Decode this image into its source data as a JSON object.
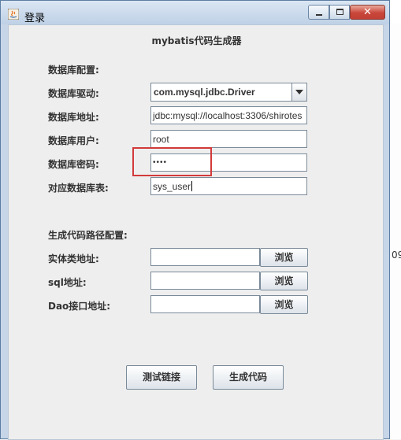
{
  "window": {
    "title": "登录",
    "form_title": "mybatis代码生成器"
  },
  "db_config": {
    "section_label": "数据库配置:",
    "driver_label": "数据库驱动:",
    "driver_value": "com.mysql.jdbc.Driver",
    "url_label": "数据库地址:",
    "url_value": "jdbc:mysql://localhost:3306/shirotes",
    "user_label": "数据库用户:",
    "user_value": "root",
    "password_label": "数据库密码:",
    "password_value": "••••",
    "table_label": "对应数据库表:",
    "table_value": "sys_user"
  },
  "path_config": {
    "section_label": "生成代码路径配置:",
    "entity_label": "实体类地址:",
    "entity_value": "",
    "sql_label": "sql地址:",
    "sql_value": "",
    "dao_label": "Dao接口地址:",
    "dao_value": "",
    "browse_label": "浏览"
  },
  "actions": {
    "test_label": "测试链接",
    "generate_label": "生成代码"
  },
  "background": {
    "right_peek": "09"
  },
  "colors": {
    "highlight": "#d33a3a",
    "close_button": "#c9463a"
  }
}
